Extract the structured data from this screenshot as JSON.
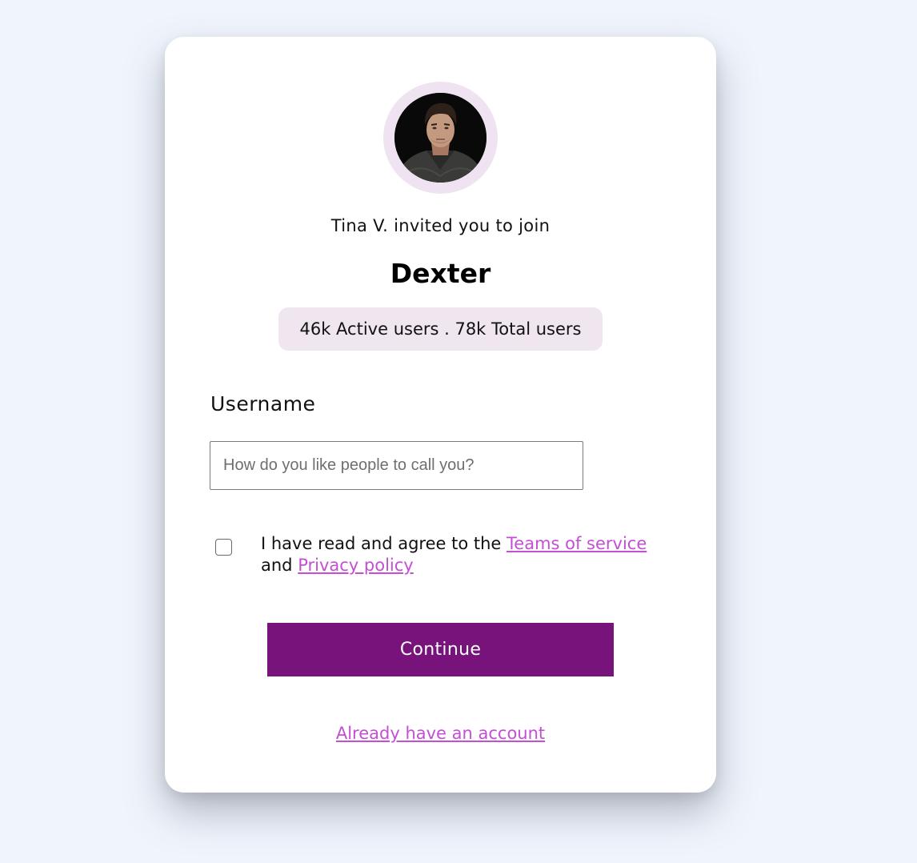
{
  "invite": {
    "inviter_text": "Tina V. invited you to join",
    "team_name": "Dexter",
    "stats": "46k Active users . 78k Total users"
  },
  "form": {
    "username_label": "Username",
    "username_placeholder": "How do you like people to call you?",
    "username_value": "",
    "agree_checked": false,
    "agree_prefix": "I have read and agree to the ",
    "terms_link": "Teams of service",
    "agree_middle": " and ",
    "privacy_link": "Privacy policy",
    "continue_label": "Continue",
    "account_link": "Already have an account"
  },
  "colors": {
    "page_background": "#f0f5fd",
    "card_background": "#ffffff",
    "avatar_ring": "#efe3f1",
    "stats_badge": "#efe6ef",
    "primary_button": "#77137b",
    "link": "#c44fd4"
  },
  "icons": {
    "avatar": "profile-photo"
  }
}
